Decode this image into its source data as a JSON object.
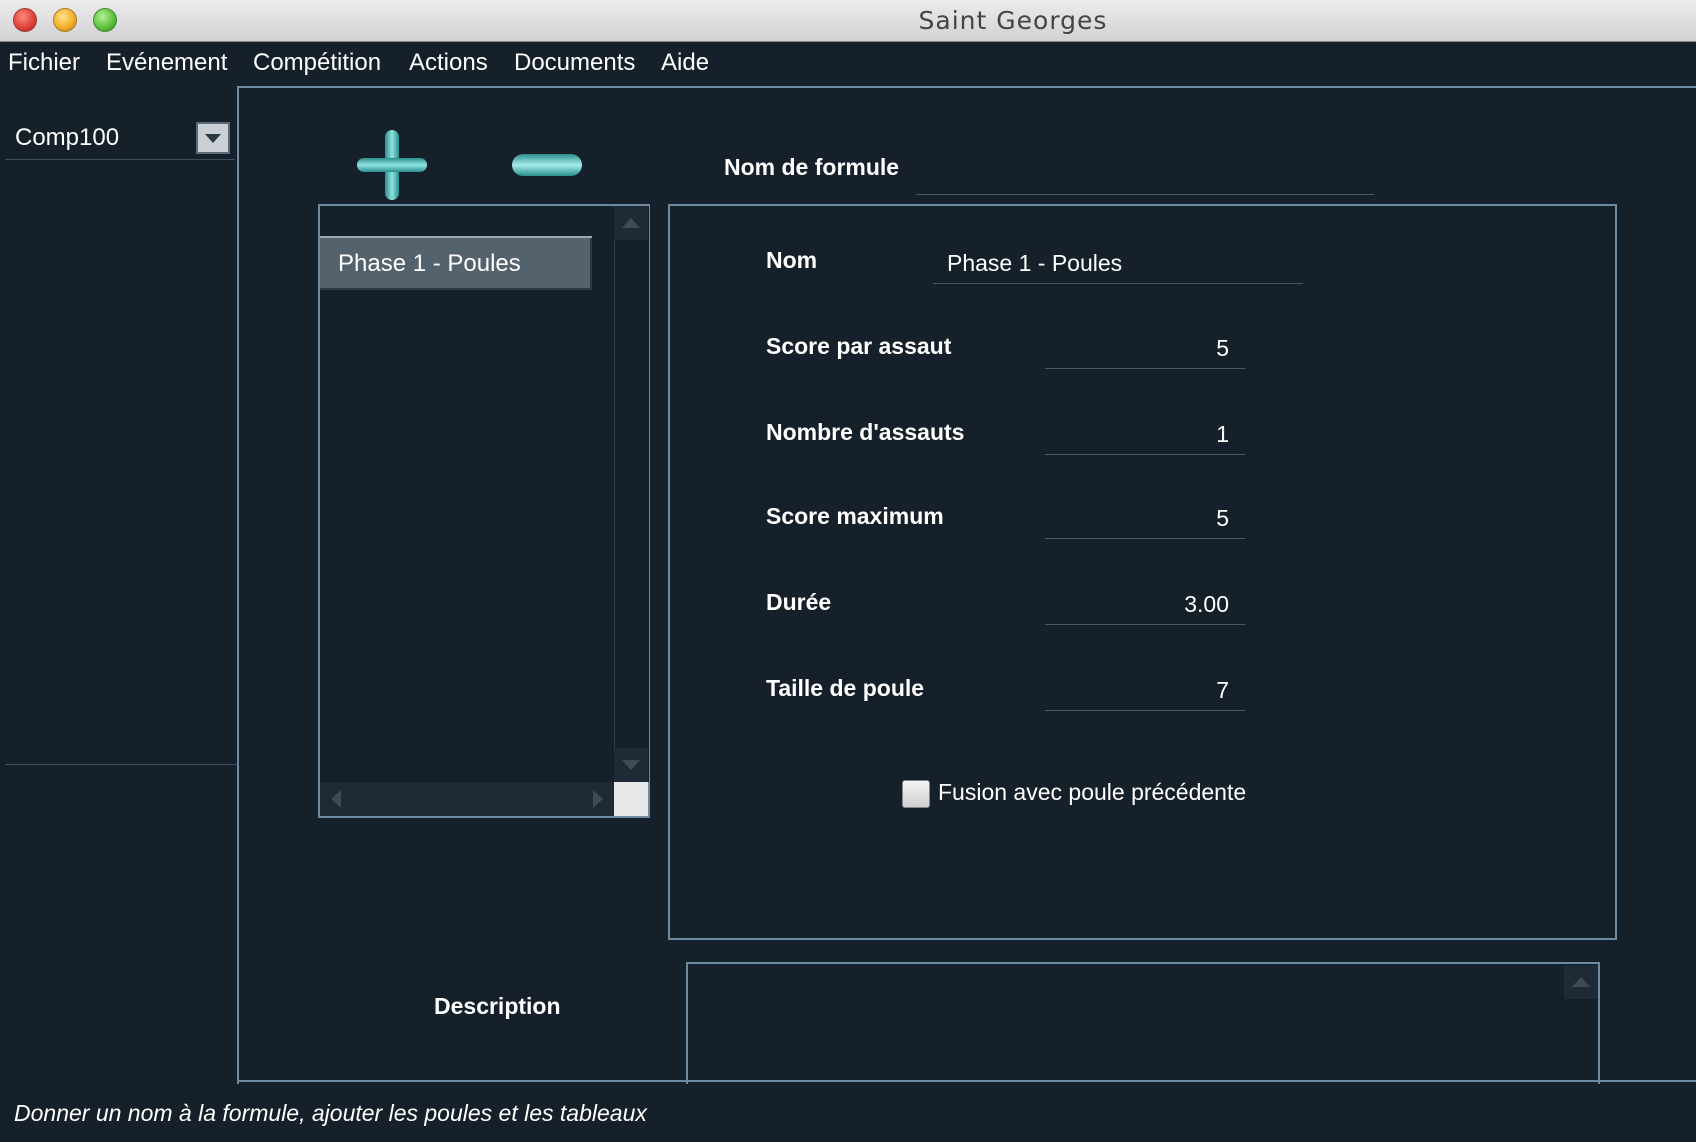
{
  "window": {
    "title": "Saint Georges"
  },
  "menu": {
    "items": [
      "Fichier",
      "Evénement",
      "Compétition",
      "Actions",
      "Documents",
      "Aide"
    ]
  },
  "competition": {
    "selected": "Comp100"
  },
  "phases": {
    "items": [
      "Phase 1 - Poules"
    ]
  },
  "formula": {
    "label": "Nom de formule",
    "value": ""
  },
  "props": {
    "nom_label": "Nom",
    "nom_value": "Phase 1 - Poules",
    "score_assaut_label": "Score par assaut",
    "score_assaut_value": "5",
    "nb_assauts_label": "Nombre d'assauts",
    "nb_assauts_value": "1",
    "score_max_label": "Score maximum",
    "score_max_value": "5",
    "duree_label": "Durée",
    "duree_value": "3.00",
    "taille_label": "Taille de poule",
    "taille_value": "7",
    "fusion_label": "Fusion avec poule précédente",
    "fusion_checked": false
  },
  "description": {
    "label": "Description",
    "value": ""
  },
  "status": {
    "text": "Donner un nom à la formule, ajouter les poules et les tableaux"
  },
  "colors": {
    "background": "#16202a",
    "border": "#6e8aa0",
    "accent": "#3fb3b0",
    "selected_row": "#54626e"
  }
}
